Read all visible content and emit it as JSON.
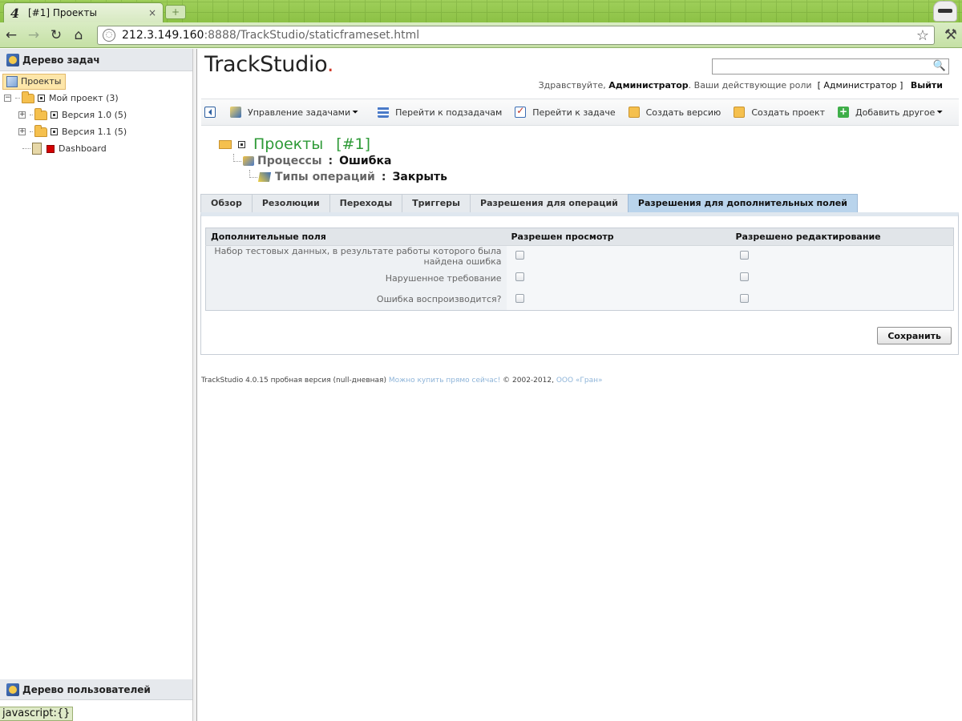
{
  "browser": {
    "tab_title": "[#1] Проекты",
    "tab_close": "×",
    "new_tab": "+",
    "favicon": "4",
    "address_host": "212.3.149.160",
    "address_rest": ":8888/TrackStudio/staticframeset.html",
    "back": "←",
    "forward": "→",
    "reload": "↻",
    "home": "⌂",
    "bookmark": "☆",
    "wrench": "🔧"
  },
  "left_panel": {
    "tasks_title": "Дерево задач",
    "tree": [
      {
        "label": "Проекты",
        "selected": true
      },
      {
        "label": "Мой проект (3)"
      },
      {
        "label": "Версия 1.0 (5)"
      },
      {
        "label": "Версия 1.1 (5)"
      },
      {
        "label": "Dashboard"
      }
    ],
    "users_title": "Дерево пользователей",
    "status_bubble": "javascript:{}"
  },
  "header": {
    "logo_text": "TrackStudio",
    "logo_dot": ".",
    "search_value": "",
    "greeting_prefix": "Здравствуйте,",
    "user_name": "Администратор",
    "roles_text": ". Ваши действующие роли",
    "role_open": "[",
    "role_name": "Администратор",
    "role_close": "]",
    "logout": "Выйти"
  },
  "actions": [
    {
      "label": "Управление задачами",
      "caret": "⏷"
    },
    {
      "label": "Перейти к подзадачам"
    },
    {
      "label": "Перейти к задаче"
    },
    {
      "label": "Создать версию"
    },
    {
      "label": "Создать проект"
    },
    {
      "label": "Добавить другое",
      "caret": "⏷"
    }
  ],
  "breadcrumb": {
    "title": "Проекты",
    "id": "[#1]",
    "level2_label": "Процессы",
    "level2_value": "Ошибка",
    "level3_label": "Типы операций",
    "level3_value": "Закрыть",
    "separator": ":"
  },
  "tabs": [
    {
      "label": "Обзор"
    },
    {
      "label": "Резолюции"
    },
    {
      "label": "Переходы"
    },
    {
      "label": "Триггеры"
    },
    {
      "label": "Разрешения для операций"
    },
    {
      "label": "Разрешения для дополнительных полей",
      "active": true
    }
  ],
  "fields_table": {
    "headers": [
      "Дополнительные поля",
      "Разрешен просмотр",
      "Разрешено редактирование"
    ],
    "rows": [
      {
        "name": "Набор тестовых данных, в результате работы которого была найдена ошибка",
        "view": false,
        "edit": false
      },
      {
        "name": "Нарушенное требование",
        "view": false,
        "edit": false
      },
      {
        "name": "Ошибка воспроизводится?",
        "view": false,
        "edit": false
      }
    ],
    "save_label": "Сохранить"
  },
  "footer": {
    "text": "TrackStudio 4.0.15 пробная версия (null-дневная)",
    "buy_link": "Можно купить прямо сейчас!",
    "copyright": "© 2002-2012,",
    "company_link": "ООО «Гран»"
  }
}
